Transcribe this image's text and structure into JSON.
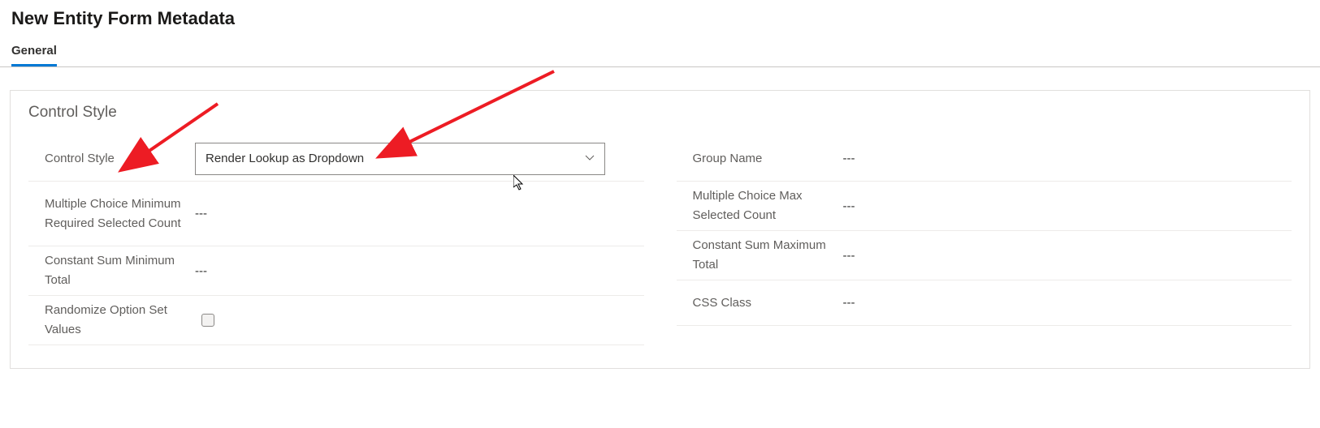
{
  "header": {
    "title": "New Entity Form Metadata"
  },
  "tabs": {
    "general": "General"
  },
  "section": {
    "title": "Control Style",
    "left": {
      "control_style_label": "Control Style",
      "control_style_value": "Render Lookup as Dropdown",
      "multiple_choice_min_label": "Multiple Choice Minimum Required Selected Count",
      "multiple_choice_min_value": "---",
      "constant_sum_min_label": "Constant Sum Minimum Total",
      "constant_sum_min_value": "---",
      "randomize_label": "Randomize Option Set Values"
    },
    "right": {
      "group_name_label": "Group Name",
      "group_name_value": "---",
      "multiple_choice_max_label": "Multiple Choice Max Selected Count",
      "multiple_choice_max_value": "---",
      "constant_sum_max_label": "Constant Sum Maximum Total",
      "constant_sum_max_value": "---",
      "css_class_label": "CSS Class",
      "css_class_value": "---"
    }
  }
}
